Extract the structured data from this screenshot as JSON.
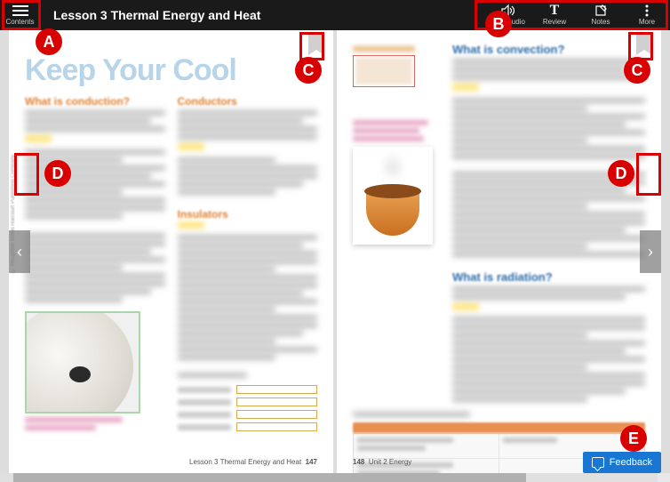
{
  "topbar": {
    "contents_label": "Contents",
    "lesson_title": "Lesson 3 Thermal Energy and Heat",
    "tools": {
      "play_audio": "Play Audio",
      "review": "Review",
      "notes": "Notes",
      "more": "More"
    }
  },
  "left_page": {
    "title": "Keep Your Cool",
    "section1": "What is conduction?",
    "section2": "Conductors",
    "section3": "Insulators",
    "footer_text": "Lesson 3 Thermal Energy and Heat",
    "footer_page": "147",
    "copyright": "© Houghton Mifflin Harcourt Publishing Company"
  },
  "right_page": {
    "section1": "What is convection?",
    "section2": "What is radiation?",
    "footer_text": "Unit 2 Energy",
    "footer_page": "148"
  },
  "nav": {
    "prev": "‹",
    "next": "›"
  },
  "feedback": {
    "label": "Feedback"
  },
  "annotations": {
    "A": "A",
    "B": "B",
    "C": "C",
    "D": "D",
    "E": "E"
  }
}
